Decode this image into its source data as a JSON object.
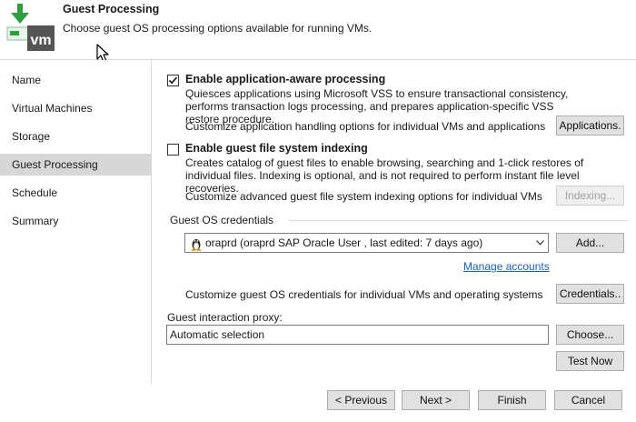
{
  "header": {
    "title": "Guest Processing",
    "subtitle": "Choose guest OS processing options available for running VMs.",
    "logo_text": "vm"
  },
  "sidebar": {
    "items": [
      {
        "label": "Name"
      },
      {
        "label": "Virtual Machines"
      },
      {
        "label": "Storage"
      },
      {
        "label": "Guest Processing"
      },
      {
        "label": "Schedule"
      },
      {
        "label": "Summary"
      }
    ],
    "active_index": 3
  },
  "app_aware": {
    "label": "Enable application-aware processing",
    "checked": true,
    "description": "Quiesces applications using Microsoft VSS to ensure transactional consistency, performs transaction logs processing, and prepares application-specific VSS restore procedure.",
    "customize_text": "Customize application handling options for individual VMs and applications",
    "button_label": "Applications."
  },
  "indexing": {
    "label": "Enable guest file system indexing",
    "checked": false,
    "description": "Creates catalog of guest files to enable browsing, searching and 1-click restores of individual files. Indexing is optional, and is not required to perform instant file level recoveries.",
    "customize_text": "Customize advanced guest file system indexing options for individual VMs",
    "button_label": "Indexing..."
  },
  "credentials": {
    "group_label": "Guest OS credentials",
    "selected": "oraprd (oraprd SAP Oracle User , last edited: 7 days ago)",
    "add_label": "Add...",
    "manage_link": "Manage accounts",
    "customize_text": "Customize guest OS credentials for individual VMs and operating systems",
    "button_label": "Credentials.."
  },
  "proxy": {
    "label": "Guest interaction proxy:",
    "value": "Automatic selection",
    "choose_label": "Choose...",
    "test_label": "Test Now"
  },
  "footer": {
    "previous": "< Previous",
    "next": "Next >",
    "finish": "Finish",
    "cancel": "Cancel"
  },
  "colors": {
    "accent_green": "#2e9e3e",
    "logo_box": "#555555",
    "active_nav": "#d7d7d7",
    "link": "#1a5fb4"
  }
}
